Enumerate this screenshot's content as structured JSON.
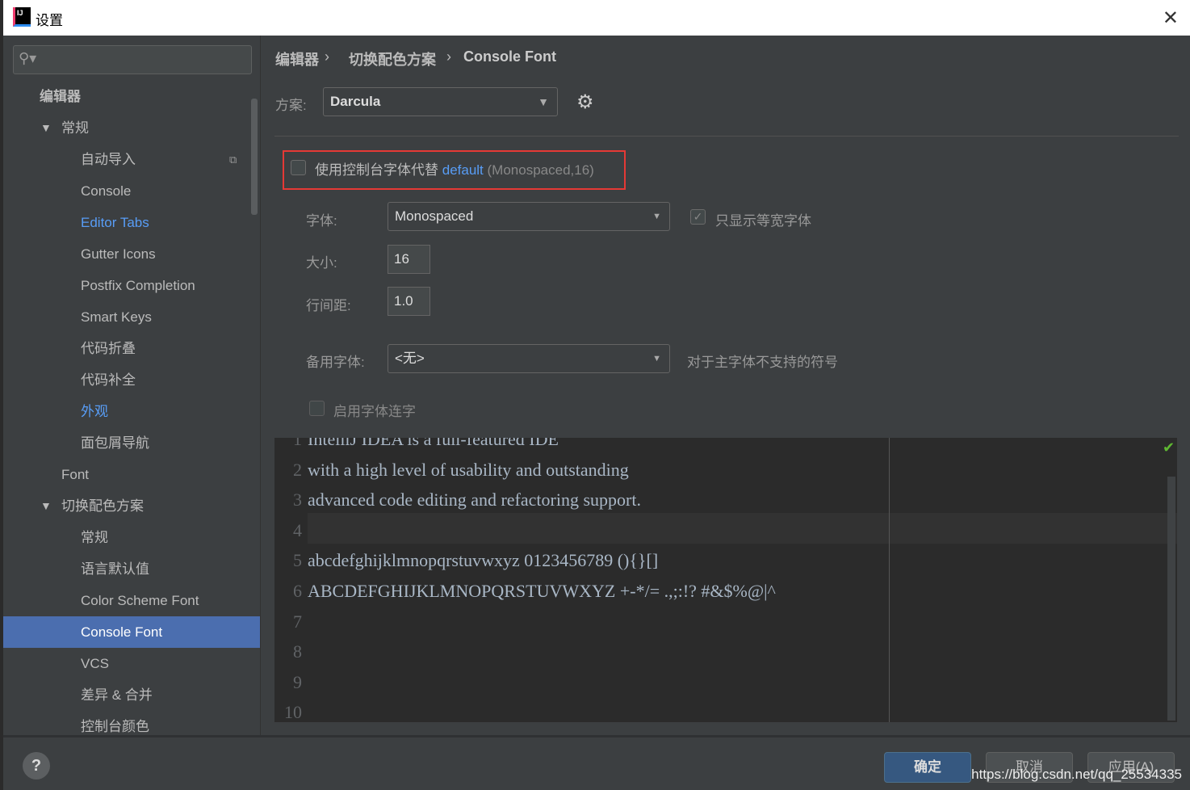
{
  "window": {
    "title": "设置",
    "close": "✕"
  },
  "sidebar": {
    "search_placeholder": "",
    "items": [
      {
        "label": "编辑器",
        "level": 0
      },
      {
        "label": "常规",
        "level": 1,
        "expanded": true
      },
      {
        "label": "自动导入",
        "level": 2
      },
      {
        "label": "Console",
        "level": 2
      },
      {
        "label": "Editor Tabs",
        "level": 2
      },
      {
        "label": "Gutter Icons",
        "level": 2
      },
      {
        "label": "Postfix Completion",
        "level": 2
      },
      {
        "label": "Smart Keys",
        "level": 2
      },
      {
        "label": "代码折叠",
        "level": 2
      },
      {
        "label": "代码补全",
        "level": 2
      },
      {
        "label": "外观",
        "level": 2
      },
      {
        "label": "面包屑导航",
        "level": 2
      },
      {
        "label": "Font",
        "level": 1
      },
      {
        "label": "切换配色方案",
        "level": 1,
        "expanded": true
      },
      {
        "label": "常规",
        "level": 2
      },
      {
        "label": "语言默认值",
        "level": 2
      },
      {
        "label": "Color Scheme Font",
        "level": 2
      },
      {
        "label": "Console Font",
        "level": 2,
        "selected": true
      },
      {
        "label": "VCS",
        "level": 2
      },
      {
        "label": "差异 & 合并",
        "level": 2
      },
      {
        "label": "控制台颜色",
        "level": 2
      }
    ]
  },
  "breadcrumb": [
    "编辑器",
    "切换配色方案",
    "Console Font"
  ],
  "scheme": {
    "label": "方案:",
    "value": "Darcula"
  },
  "use_console_font": {
    "checked": false,
    "text": "使用控制台字体代替",
    "link": "default",
    "detail": "(Monospaced,16)"
  },
  "font": {
    "label": "字体:",
    "value": "Monospaced",
    "mono_only_label": "只显示等宽字体",
    "mono_only_checked": true
  },
  "size": {
    "label": "大小:",
    "value": "16"
  },
  "line_spacing": {
    "label": "行间距:",
    "value": "1.0"
  },
  "fallback": {
    "label": "备用字体:",
    "value": "<无>",
    "hint": "对于主字体不支持的符号"
  },
  "ligatures": {
    "label": "启用字体连字",
    "checked": false
  },
  "preview": {
    "lines": [
      "IntelliJ IDEA is a full-featured IDE",
      "with a high level of usability and outstanding",
      "advanced code editing and refactoring support.",
      "",
      "abcdefghijklmnopqrstuvwxyz 0123456789 (){}[]",
      "ABCDEFGHIJKLMNOPQRSTUVWXYZ +-*/= .,;:!? #&$%@|^",
      "",
      "",
      "",
      ""
    ],
    "line_numbers": [
      "1",
      "2",
      "3",
      "4",
      "5",
      "6",
      "7",
      "8",
      "9",
      "10"
    ]
  },
  "buttons": {
    "ok": "确定",
    "cancel": "取消",
    "apply": "应用(A)",
    "help": "?"
  },
  "watermark": "https://blog.csdn.net/qq_25534335",
  "colors": {
    "selection": "#4b6eaf",
    "link": "#589df6",
    "highlight_box": "#e53935"
  }
}
